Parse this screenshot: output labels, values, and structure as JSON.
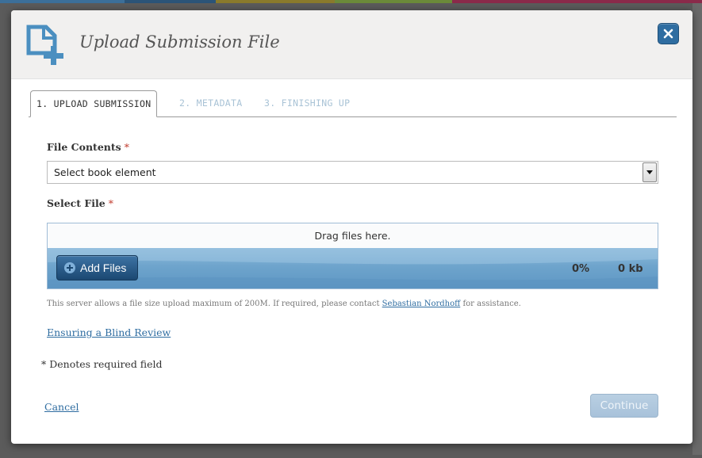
{
  "modal": {
    "title": "Upload Submission File",
    "close_label": "Close"
  },
  "tabs": [
    {
      "label": "1. UPLOAD SUBMISSION",
      "active": true
    },
    {
      "label": "2. METADATA",
      "active": false
    },
    {
      "label": "3. FINISHING UP",
      "active": false
    }
  ],
  "form": {
    "file_contents_label": "File Contents",
    "required_mark": "*",
    "file_contents_value": "Select book element",
    "select_file_label": "Select File",
    "drop_zone_text": "Drag files here.",
    "add_files_label": "Add Files",
    "progress_percent": "0%",
    "uploaded_size": "0 kb",
    "note_prefix": "This server allows a file size upload maximum of 200M. If required, please contact",
    "note_contact": "Sebastian Nordhoff",
    "note_suffix": "for assistance.",
    "blind_review_link": "Ensuring a Blind Review",
    "required_field_note": "* Denotes required field"
  },
  "footer": {
    "cancel_label": "Cancel",
    "continue_label": "Continue"
  },
  "colors": {
    "accent": "#2f6da1",
    "header_bg": "#f1f0ef",
    "upload_bar": "#6ea4cc",
    "continue_disabled": "#a8c2da",
    "required": "#c0392b"
  }
}
